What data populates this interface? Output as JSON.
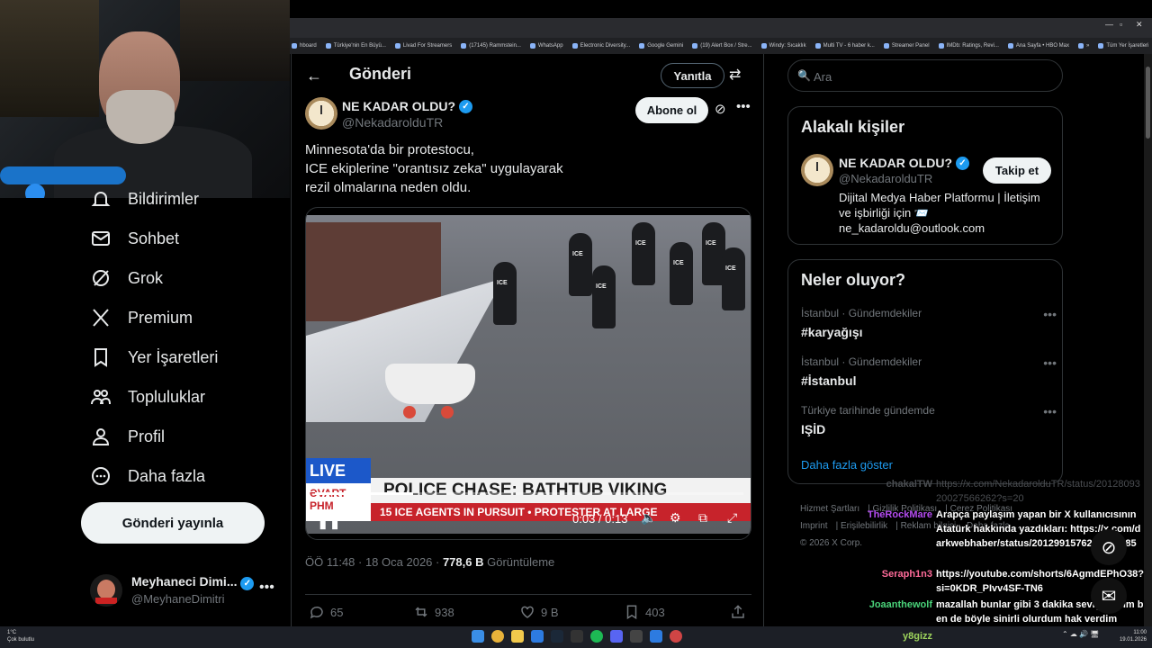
{
  "browser": {
    "bookmarks": [
      "hboard",
      "Türkiye'nin En Büyü...",
      "Livad For Streamers",
      "(17145) Rammstein...",
      "WhatsApp",
      "Electronic Diversity...",
      "Google Gemini",
      "(19) Alert Box / Stre...",
      "Windy: Sıcaklık",
      "Multi TV - 6 haber k...",
      "Streamer Panel",
      "IMDb: Ratings, Revi...",
      "Ana Sayfa • HBO Max",
      "»",
      "Tüm Yer İşaretleri"
    ]
  },
  "nav": {
    "items": [
      {
        "label": "Bildirimler",
        "icon": "bell-icon"
      },
      {
        "label": "Sohbet",
        "icon": "mail-icon"
      },
      {
        "label": "Grok",
        "icon": "grok-icon"
      },
      {
        "label": "Premium",
        "icon": "x-logo-icon"
      },
      {
        "label": "Yer İşaretleri",
        "icon": "bookmark-icon"
      },
      {
        "label": "Topluluklar",
        "icon": "communities-icon"
      },
      {
        "label": "Profil",
        "icon": "profile-icon"
      },
      {
        "label": "Daha fazla",
        "icon": "more-circle-icon"
      }
    ],
    "post_button": "Gönderi yayınla",
    "account": {
      "name": "Meyhaneci Dimi...",
      "handle": "@MeyhaneDimitri",
      "more": "•••"
    }
  },
  "post": {
    "header_title": "Gönderi",
    "reply_label": "Yanıtla",
    "author_name": "NE KADAR OLDU?",
    "author_handle": "@NekadarolduTR",
    "subscribe_label": "Abone ol",
    "text": "Minnesota'da bir protestocu,\nICE ekiplerine \"orantısız zeka\" uygulayarak\nrezil olmalarına neden oldu.",
    "video": {
      "live_label": "LIVE",
      "channel_label": "ƏVART",
      "headline": "POLICE CHASE: BATHTUB VIKING",
      "subheadline": "15 ICE AGENTS IN PURSUIT • PROTESTER AT LARGE",
      "ticker_left": "PHM",
      "time": "0:03 / 0:13",
      "progress": 0.23,
      "officer_badge": "ICE"
    },
    "timestamp": "ÖÖ 11:48 · 18 Oca 2026 · ",
    "views": "778,6 B",
    "views_label": " Görüntüleme",
    "stats": {
      "replies": "65",
      "reposts": "938",
      "likes": "9 B",
      "bookmarks": "403"
    }
  },
  "right": {
    "search_placeholder": "Ara",
    "related_title": "Alakalı kişiler",
    "related": {
      "name": "NE KADAR OLDU?",
      "handle": "@NekadarolduTR",
      "follow": "Takip et",
      "bio": "Dijital Medya Haber Platformu | İletişim ve işbirliği için 📨 ne_kadaroldu@outlook.com"
    },
    "trends_title": "Neler oluyor?",
    "trends": [
      {
        "category": "İstanbul · Gündemdekiler",
        "title": "#karyağışı"
      },
      {
        "category": "İstanbul · Gündemdekiler",
        "title": "#İstanbul"
      },
      {
        "category": "Türkiye tarihinde gündemde",
        "title": "IŞİD"
      }
    ],
    "show_more": "Daha fazla göster",
    "footer": [
      "Hizmet Şartları",
      "Gizlilik Politikası",
      "Çerez Politikası",
      "Imprint",
      "Erişilebilirlik",
      "Reklam bilgisi",
      "Daha fazla ...",
      "© 2026 X Corp."
    ]
  },
  "chat": [
    {
      "user": "chakalTW",
      "text": "https://x.com/NekadarolduTR/status/2012809320027566262?s=20",
      "dim": true,
      "color": "#4a4d51"
    },
    {
      "user": "TheRockMare",
      "text": "Arapça paylaşım yapan bir X kullanıcısının Atatürk hakkında yazdıkları: https://x.com/darkwebhaber/status/2012991576247566385",
      "dim": false,
      "color": "#b44cf0"
    },
    {
      "user": "Seraph1n3",
      "text": "https://youtube.com/shorts/6AgmdEPhO38?si=0KDR_PIvv4SF-TN6",
      "dim": false,
      "color": "#ff6b9a"
    },
    {
      "user": "Joaanthewolf",
      "text": "mazallah bunlar gibi 3 dakika sevişseydim ben de böyle sinirli olurdum hak verdim",
      "dim": false,
      "color": "#4ad47a"
    }
  ],
  "taskbar": {
    "weather_temp": "1°C",
    "weather_desc": "Çok bulutlu",
    "nick": "y8gizz",
    "time": "11:00",
    "date": "19.01.2026"
  }
}
